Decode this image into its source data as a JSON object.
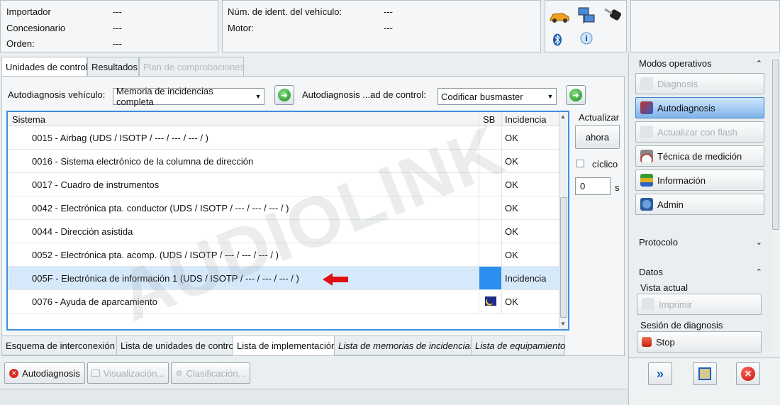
{
  "header": {
    "left": [
      {
        "label": "Importador",
        "value": "---"
      },
      {
        "label": "Concesionario",
        "value": "---"
      },
      {
        "label": "Orden:",
        "value": "---"
      }
    ],
    "mid": [
      {
        "label": "Núm. de ident. del vehículo:",
        "value": "---"
      },
      {
        "label": "Motor:",
        "value": "---"
      }
    ]
  },
  "tabs": [
    {
      "label": "Unidades de control"
    },
    {
      "label": "Resultados"
    },
    {
      "label": "Plan de comprobaciones"
    }
  ],
  "controls": {
    "auto_vehicle_label": "Autodiagnosis vehículo:",
    "auto_vehicle_value": "Memoria de incidencias completa",
    "auto_unit_label": "Autodiagnosis ...ad de control:",
    "auto_unit_value": "Codificar busmaster"
  },
  "table": {
    "headers": {
      "system": "Sistema",
      "sb": "SB",
      "incidence": "Incidencia"
    },
    "rows": [
      {
        "system": "0015 - Airbag  (UDS / ISOTP / --- / --- / --- /  )",
        "incidence": "OK"
      },
      {
        "system": "0016 - Sistema electrónico de la columna de dirección",
        "incidence": "OK"
      },
      {
        "system": "0017 - Cuadro de instrumentos",
        "incidence": "OK"
      },
      {
        "system": "0042 - Electrónica pta. conductor  (UDS / ISOTP / --- / --- / --- /  )",
        "incidence": "OK"
      },
      {
        "system": "0044 - Dirección asistida",
        "incidence": "OK"
      },
      {
        "system": "0052 - Electrónica pta. acomp.  (UDS / ISOTP / --- / --- / --- /  )",
        "incidence": "OK"
      },
      {
        "system": "005F - Electrónica de información 1  (UDS / ISOTP / --- / --- / --- /  )",
        "incidence": "Incidencia"
      },
      {
        "system": "0076 - Ayuda de aparcamiento",
        "incidence": "OK"
      }
    ]
  },
  "refresh": {
    "label": "Actualizar",
    "now": "ahora",
    "cyclic": "cíclico",
    "interval": "0",
    "unit": "s"
  },
  "bottom_tabs": [
    {
      "label": "Esquema de interconexión"
    },
    {
      "label": "Lista de unidades de control"
    },
    {
      "label": "Lista de implementación"
    },
    {
      "label": "Lista de memorias de incidencias"
    },
    {
      "label": "Lista de equipamiento"
    }
  ],
  "footer_buttons": [
    {
      "label": "Autodiagnosis"
    },
    {
      "label": "Visualización..."
    },
    {
      "label": "Clasificación..."
    }
  ],
  "right": {
    "modes_title": "Modos operativos",
    "modes": [
      {
        "label": "Diagnosis"
      },
      {
        "label": "Autodiagnosis"
      },
      {
        "label": "Actualizar con flash"
      },
      {
        "label": "Técnica de medición"
      },
      {
        "label": "Información"
      },
      {
        "label": "Admin"
      }
    ],
    "protocol": "Protocolo",
    "data": "Datos",
    "current_view": "Vista actual",
    "print": "Imprimir",
    "session": "Sesión de diagnosis",
    "stop": "Stop"
  },
  "watermark": "AUDIOLINK",
  "colors": {
    "accent": "#3c8ee0",
    "selected_row": "#d6e9fb",
    "sb_fault": "#2a8ff0"
  }
}
